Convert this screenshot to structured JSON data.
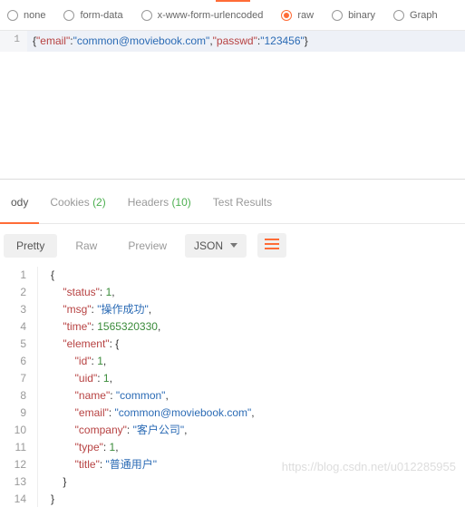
{
  "bodyTypes": {
    "items": [
      {
        "label": "none"
      },
      {
        "label": "form-data"
      },
      {
        "label": "x-www-form-urlencoded"
      },
      {
        "label": "raw"
      },
      {
        "label": "binary"
      },
      {
        "label": "Graph"
      }
    ],
    "selected": "raw"
  },
  "request": {
    "lineNo": "1",
    "keys": {
      "email": "\"email\"",
      "passwd": "\"passwd\""
    },
    "vals": {
      "email": "\"common@moviebook.com\"",
      "passwd": "\"123456\""
    }
  },
  "responseTabs": {
    "body": "ody",
    "cookies": "Cookies",
    "cookiesCount": "(2)",
    "headers": "Headers",
    "headersCount": "(10)",
    "testResults": "Test Results"
  },
  "viewControls": {
    "pretty": "Pretty",
    "raw": "Raw",
    "preview": "Preview",
    "json": "JSON"
  },
  "json": {
    "lines": [
      "1",
      "2",
      "3",
      "4",
      "5",
      "6",
      "7",
      "8",
      "9",
      "10",
      "11",
      "12",
      "13",
      "14"
    ],
    "status_k": "\"status\"",
    "status_v": "1",
    "msg_k": "\"msg\"",
    "msg_v": "\"操作成功\"",
    "time_k": "\"time\"",
    "time_v": "1565320330",
    "element_k": "\"element\"",
    "id_k": "\"id\"",
    "id_v": "1",
    "uid_k": "\"uid\"",
    "uid_v": "1",
    "name_k": "\"name\"",
    "name_v": "\"common\"",
    "email_k": "\"email\"",
    "email_v": "\"common@moviebook.com\"",
    "company_k": "\"company\"",
    "company_v": "\"客户公司\"",
    "type_k": "\"type\"",
    "type_v": "1",
    "title_k": "\"title\"",
    "title_v": "\"普通用户\""
  },
  "watermark": "https://blog.csdn.net/u012285955"
}
